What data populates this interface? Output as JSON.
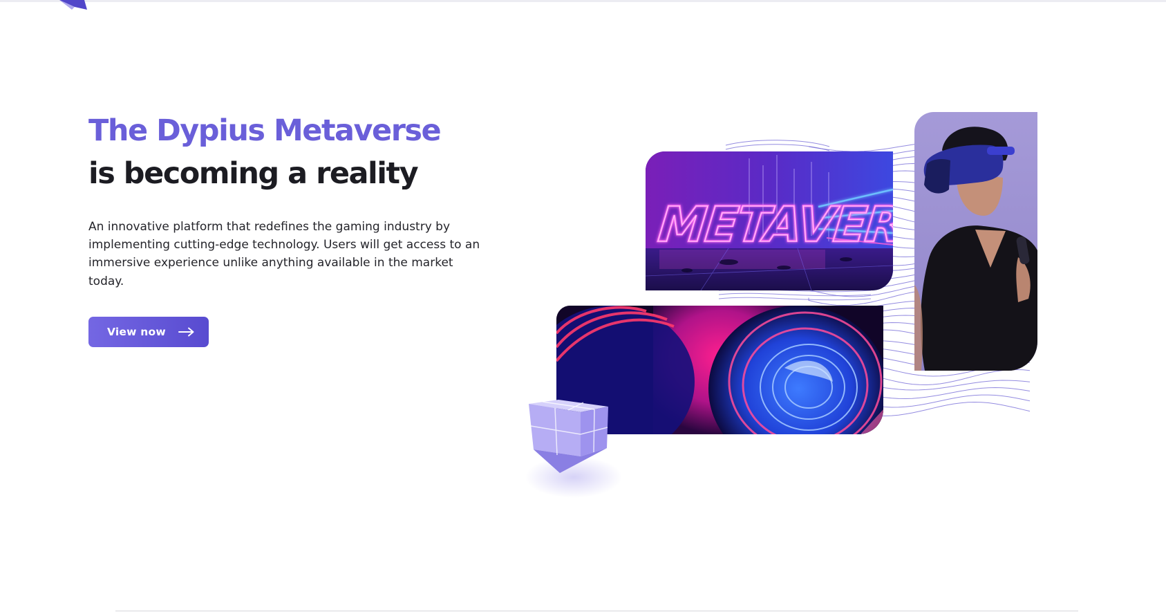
{
  "hero": {
    "title_accent": "The Dypius Metaverse",
    "title_rest": "is becoming a reality",
    "description": "An innovative platform that redefines the gaming industry by implementing cutting-edge technology. Users will get access to an immersive experience unlike anything available in the market today.",
    "cta_label": "View now",
    "cta_icon": "arrow-right-icon"
  },
  "collage": {
    "neon_sign_text": "METAVERSE",
    "images": [
      "neon-metaverse-image",
      "neon-swirl-image",
      "vr-headset-person-image",
      "glass-cube-graphic"
    ]
  },
  "colors": {
    "accent": "#6a5fd9",
    "button_start": "#7467e3",
    "button_end": "#584bd0",
    "heading_dark": "#1c1c22",
    "wave_lines": "#6f64d6"
  }
}
